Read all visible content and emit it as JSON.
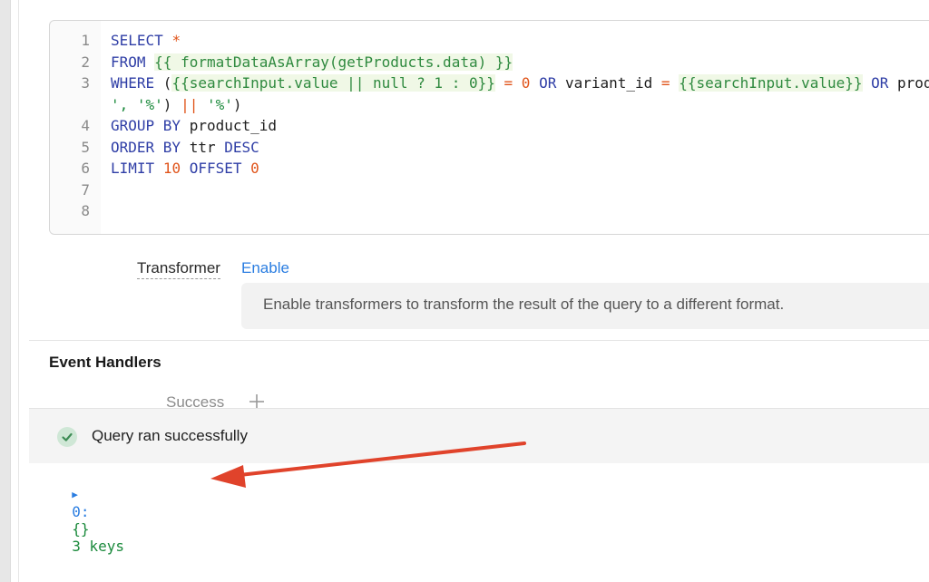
{
  "editor": {
    "lines": [
      {
        "num": "1",
        "segs": [
          {
            "t": "SELECT ",
            "c": "kw"
          },
          {
            "t": "*",
            "c": "op"
          }
        ]
      },
      {
        "num": "2",
        "segs": [
          {
            "t": "FROM ",
            "c": "kw"
          },
          {
            "t": "{{ formatDataAsArray(getProducts.data) }}",
            "c": "tmpl"
          }
        ]
      },
      {
        "num": "3",
        "segs": [
          {
            "t": "WHERE ",
            "c": "kw"
          },
          {
            "t": "(",
            "c": ""
          },
          {
            "t": "{{searchInput.value || null ? 1 : 0}}",
            "c": "tmpl"
          },
          {
            "t": " ",
            "c": ""
          },
          {
            "t": "=",
            "c": "op"
          },
          {
            "t": " ",
            "c": ""
          },
          {
            "t": "0",
            "c": "num"
          },
          {
            "t": " ",
            "c": ""
          },
          {
            "t": "OR",
            "c": "kw"
          },
          {
            "t": " variant_id ",
            "c": ""
          },
          {
            "t": "=",
            "c": "op"
          },
          {
            "t": " ",
            "c": ""
          },
          {
            "t": "{{searchInput.value}}",
            "c": "tmpl"
          },
          {
            "t": " ",
            "c": ""
          },
          {
            "t": "OR",
            "c": "kw"
          },
          {
            "t": " product_name LIKE ('%' || ",
            "c": ""
          }
        ]
      },
      {
        "num": "",
        "segs": [
          {
            "t": "', '%'",
            "c": "str"
          },
          {
            "t": ") ",
            "c": ""
          },
          {
            "t": "||",
            "c": "op"
          },
          {
            "t": " ",
            "c": ""
          },
          {
            "t": "'%'",
            "c": "str"
          },
          {
            "t": ")",
            "c": ""
          }
        ]
      },
      {
        "num": "4",
        "segs": [
          {
            "t": "GROUP BY",
            "c": "kw"
          },
          {
            "t": " product_id",
            "c": ""
          }
        ]
      },
      {
        "num": "5",
        "segs": [
          {
            "t": "ORDER BY",
            "c": "kw"
          },
          {
            "t": " ttr ",
            "c": ""
          },
          {
            "t": "DESC",
            "c": "kw"
          }
        ]
      },
      {
        "num": "6",
        "segs": [
          {
            "t": "LIMIT",
            "c": "kw"
          },
          {
            "t": " ",
            "c": ""
          },
          {
            "t": "10",
            "c": "num"
          },
          {
            "t": " ",
            "c": ""
          },
          {
            "t": "OFFSET",
            "c": "kw"
          },
          {
            "t": " ",
            "c": ""
          },
          {
            "t": "0",
            "c": "num"
          }
        ]
      },
      {
        "num": "7",
        "segs": []
      },
      {
        "num": "8",
        "segs": []
      }
    ]
  },
  "transformer": {
    "label": "Transformer",
    "enable_label": "Enable",
    "description": "Enable transformers to transform the result of the query to a different format."
  },
  "event_handlers": {
    "title": "Event Handlers",
    "success_label": "Success"
  },
  "status": {
    "message": "Query ran successfully"
  },
  "result": {
    "key": "0:",
    "type": "{}",
    "summary": "3 keys"
  },
  "colors": {
    "keyword": "#2f3ea6",
    "number": "#e0541a",
    "string": "#1b8a3c",
    "link": "#2a7de1",
    "annotation_arrow": "#e0432b"
  }
}
